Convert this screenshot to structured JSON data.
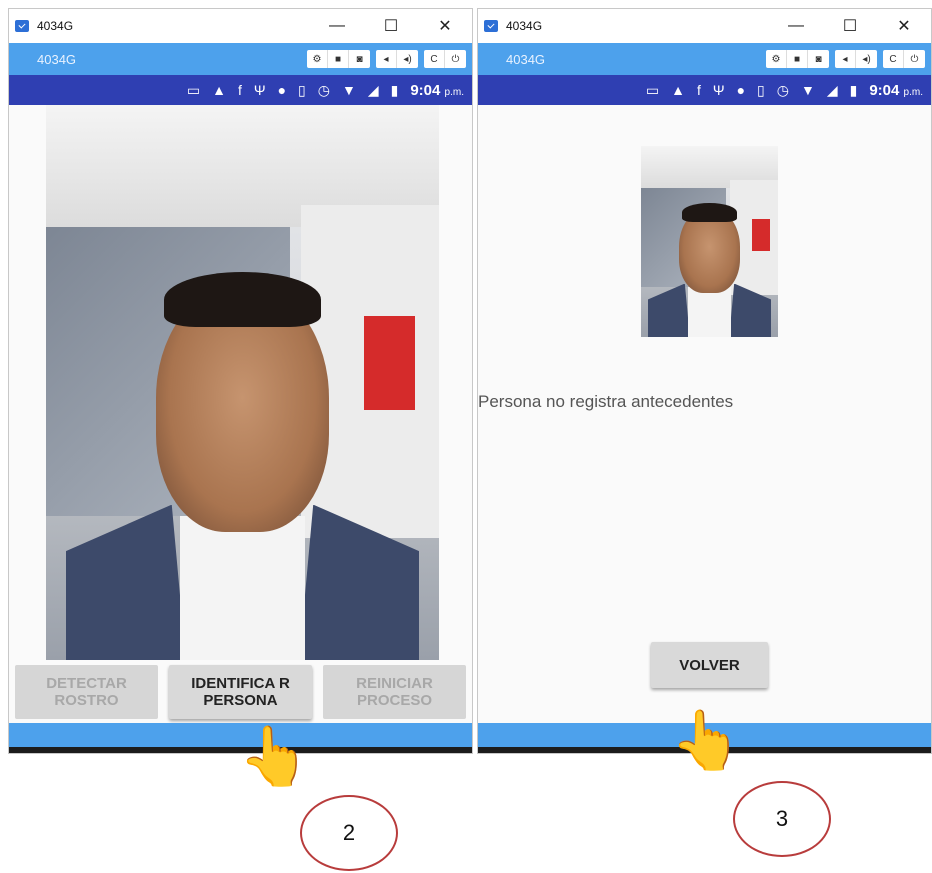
{
  "left_window": {
    "title": "4034G",
    "toolbar_name": "4034G",
    "status_time": "9:04",
    "status_ampm": "p.m.",
    "buttons": {
      "detect": "DETECTAR ROSTRO",
      "identify": "IDENTIFICA R PERSONA",
      "reset": "REINICIAR PROCESO"
    }
  },
  "right_window": {
    "title": "4034G",
    "toolbar_name": "4034G",
    "status_time": "9:04",
    "status_ampm": "p.m.",
    "message": "Persona no registra antecedentes",
    "back_button": "VOLVER"
  },
  "window_controls": {
    "minimize": "—",
    "maximize": "☐",
    "close": "✕"
  },
  "annotations": [
    {
      "label": "2"
    },
    {
      "label": "3"
    }
  ],
  "icons": {
    "hand": "👆"
  },
  "colors": {
    "toolbar": "#4da1ec",
    "statusbar": "#2f3fb2",
    "annotation_circle": "#b83c3c"
  }
}
